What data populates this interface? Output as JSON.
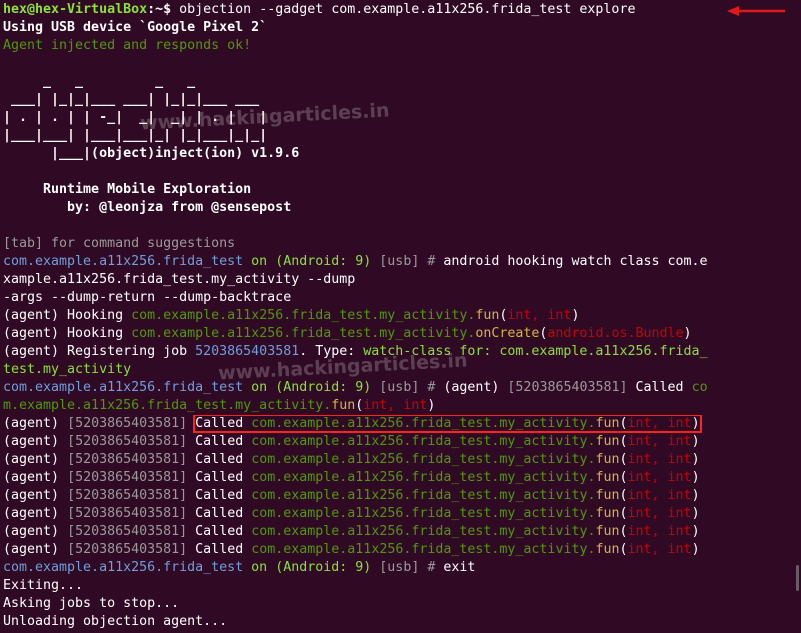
{
  "terminal": {
    "prompt_user": "hex@hex-VirtualBox",
    "prompt_sep": ":~$ ",
    "command": "objection --gadget com.example.a11x256.frida_test explore",
    "usb_line": "Using USB device `Google Pixel 2`",
    "injected": "Agent injected and responds ok!",
    "banner": [
      "     _   _         _   _",
      " ___| |_|_|___ ___| |_|_|___ ___",
      "| . | . | | -_|  _|  _| | . |   |",
      "|___|___| |___|___|_| |_|___|_|_|",
      "      |___|(object)inject(ion) v1.9.6"
    ],
    "runtime": "     Runtime Mobile Exploration",
    "byline": "        by: @leonjza from @sensepost",
    "tab_hint": "[tab] for command suggestions",
    "pkg": "com.example.a11x256.frida_test",
    "on": " on ",
    "android": "(Android: 9)",
    "usb": "[usb]",
    "hash": " # ",
    "hook_cmd_1": "android hooking watch class com.e",
    "hook_cmd_2": "xample.a11x256.frida_test.my_activity --dump",
    "hook_cmd_3": "-args --dump-return --dump-backtrace",
    "agent": "(agent)",
    "hooking": " Hooking ",
    "hook1_method": "com.example.a11x256.frida_test.my_activity.",
    "fun": "fun",
    "args_int": "int, int",
    "oncreate": "onCreate",
    "bundle": "android.os.Bundle",
    "registering": " Registering job ",
    "job_id": "5203865403581",
    "type_label": ". Type: ",
    "watch_class": "watch-class for: ",
    "watch_pkg_1": "com.example.a11x256.frida_",
    "watch_pkg_2": "test.my_activity",
    "job_bracket": "[5203865403581]",
    "called": "Called",
    "called_wrap_1": "co",
    "called_wrap_2": "m.example.a11x256.frida_test.my_activity.",
    "method_path": "com.example.a11x256.frida_test.my_activity.",
    "exit_cmd": "exit",
    "exiting": "Exiting...",
    "asking": "Asking jobs to stop...",
    "unloading": "Unloading objection agent..."
  },
  "watermark": "www.hackingarticles.in",
  "colors": {
    "background": "#300a24",
    "highlight": "#ff2020"
  }
}
